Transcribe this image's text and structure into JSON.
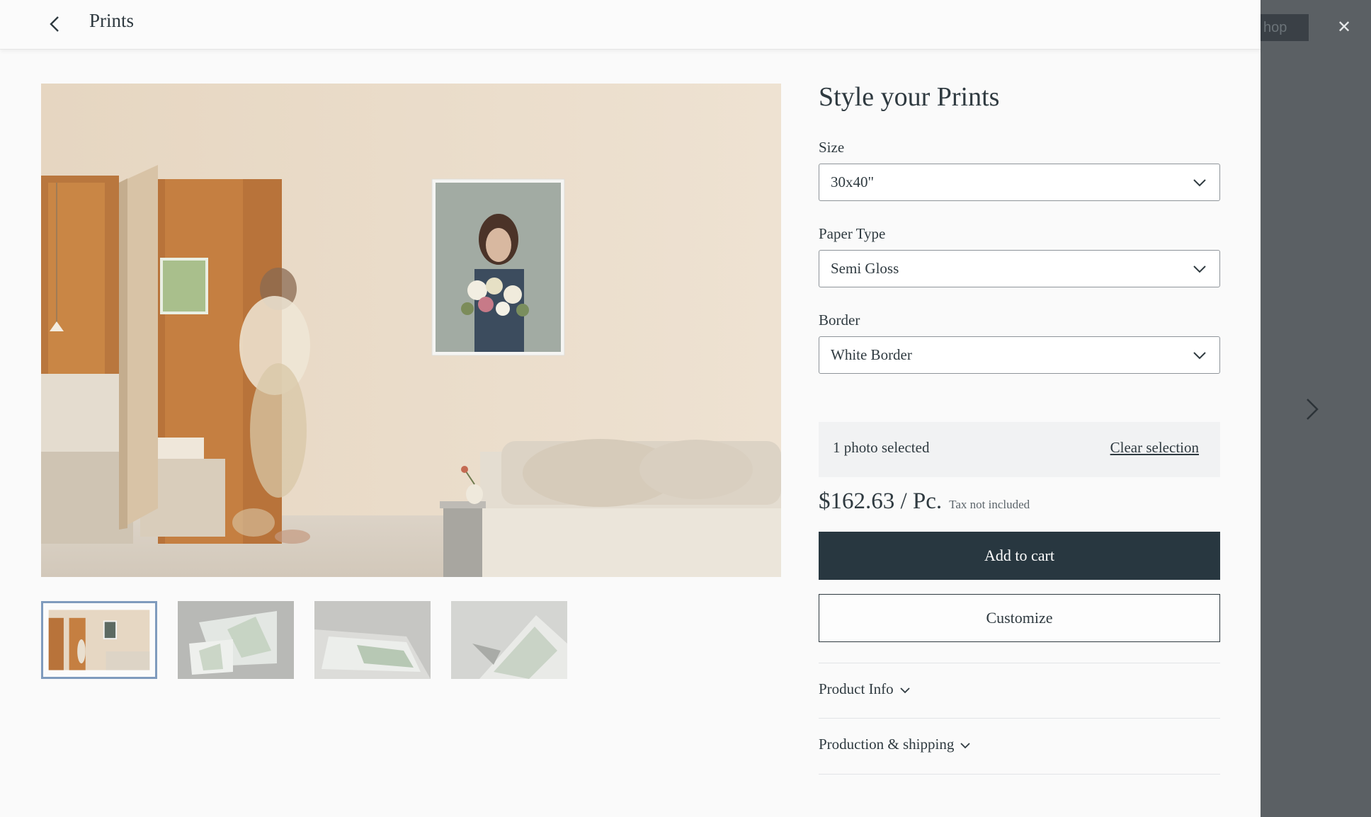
{
  "header": {
    "title": "Prints",
    "back_icon": "chevron-left-icon"
  },
  "backdrop": {
    "shop_label": "hop",
    "close_icon": "close-icon",
    "next_icon": "chevron-right-icon"
  },
  "gallery": {
    "thumbnail_count": 4,
    "selected_index": 0
  },
  "panel": {
    "heading": "Style your Prints",
    "size": {
      "label": "Size",
      "value": "30x40\""
    },
    "paper_type": {
      "label": "Paper Type",
      "value": "Semi Gloss"
    },
    "border": {
      "label": "Border",
      "value": "White Border"
    },
    "selection": {
      "count_text": "1 photo selected",
      "clear_label": "Clear selection"
    },
    "price": {
      "amount": "$162.63 / Pc.",
      "tax_note": "Tax not included"
    },
    "add_to_cart_label": "Add to cart",
    "customize_label": "Customize",
    "accordions": [
      {
        "label": "Product Info"
      },
      {
        "label": "Production & shipping"
      }
    ]
  },
  "colors": {
    "primary_button": "#283740",
    "text": "#2f3a40",
    "thumb_selected_border": "#7f9bbd",
    "backdrop": "#5b6064"
  }
}
